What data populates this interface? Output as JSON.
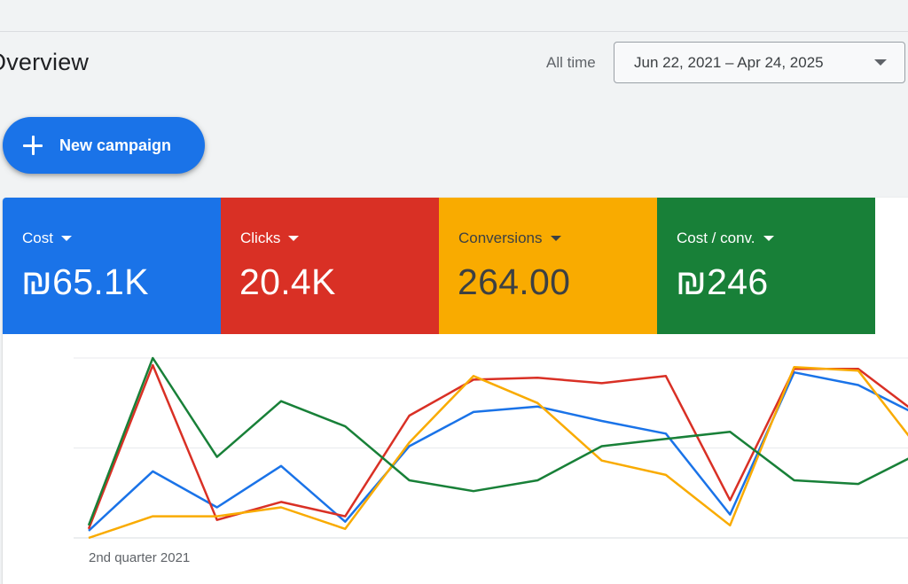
{
  "page": {
    "title": "Overview"
  },
  "date_range": {
    "label": "All time",
    "value": "Jun 22, 2021 – Apr 24, 2025"
  },
  "actions": {
    "new_campaign": "New campaign"
  },
  "colors": {
    "blue": "#1a73e8",
    "red": "#d93025",
    "yellow": "#f9ab00",
    "green": "#188038"
  },
  "metrics": [
    {
      "name": "Cost",
      "value": "₪65.1K",
      "color": "#1a73e8",
      "text_color": "#ffffff"
    },
    {
      "name": "Clicks",
      "value": "20.4K",
      "color": "#d93025",
      "text_color": "#ffffff"
    },
    {
      "name": "Conversions",
      "value": "264.00",
      "color": "#f9ab00",
      "text_color": "#3c4043"
    },
    {
      "name": "Cost / conv.",
      "value": "₪246",
      "color": "#188038",
      "text_color": "#ffffff"
    }
  ],
  "chart_data": {
    "type": "line",
    "x_tick_labels": [
      "2nd quarter 2021"
    ],
    "y_scale": "normalized per series (0–100), unlabeled axis",
    "grid": true,
    "series": [
      {
        "name": "Cost",
        "color": "#1a73e8",
        "values": [
          4,
          37,
          17,
          40,
          9,
          51,
          70,
          73,
          65,
          58,
          13,
          92,
          85,
          67
        ]
      },
      {
        "name": "Clicks",
        "color": "#d93025",
        "values": [
          5,
          96,
          10,
          20,
          12,
          68,
          88,
          89,
          86,
          90,
          21,
          94,
          94,
          67
        ]
      },
      {
        "name": "Conversions",
        "color": "#f9ab00",
        "values": [
          0,
          12,
          12,
          17,
          5,
          53,
          90,
          75,
          43,
          35,
          7,
          95,
          93,
          47
        ]
      },
      {
        "name": "Cost / conv.",
        "color": "#188038",
        "values": [
          7,
          100,
          45,
          76,
          62,
          32,
          26,
          32,
          51,
          55,
          59,
          32,
          30,
          48
        ]
      }
    ]
  }
}
